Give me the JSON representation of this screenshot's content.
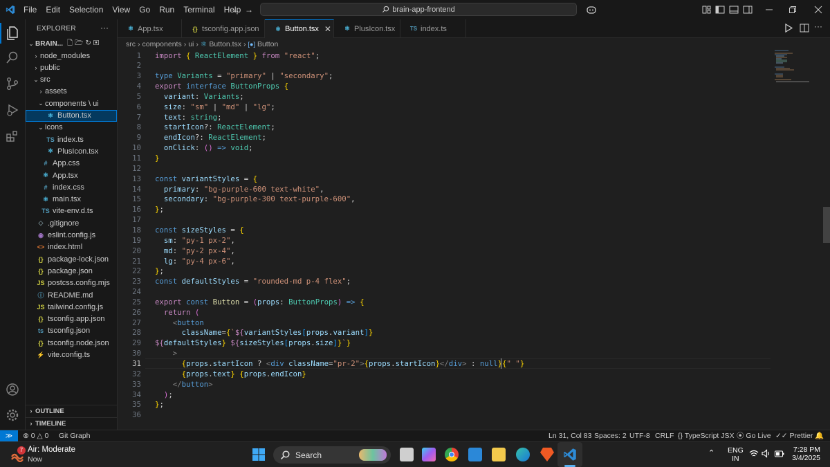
{
  "menu": [
    "File",
    "Edit",
    "Selection",
    "View",
    "Go",
    "Run",
    "Terminal",
    "Help"
  ],
  "command_center": "brain-app-frontend",
  "explorer": {
    "title": "EXPLORER",
    "root": "BRAIN...",
    "items": [
      {
        "label": "node_modules",
        "type": "folder",
        "depth": 1,
        "expanded": false
      },
      {
        "label": "public",
        "type": "folder",
        "depth": 1,
        "expanded": false
      },
      {
        "label": "src",
        "type": "folder",
        "depth": 1,
        "expanded": true
      },
      {
        "label": "assets",
        "type": "folder",
        "depth": 2,
        "expanded": false
      },
      {
        "label": "components \\ ui",
        "type": "folder",
        "depth": 2,
        "expanded": true
      },
      {
        "label": "Button.tsx",
        "type": "tsx",
        "depth": 3,
        "selected": true
      },
      {
        "label": "icons",
        "type": "folder",
        "depth": 2,
        "expanded": true
      },
      {
        "label": "index.ts",
        "type": "ts",
        "depth": 3
      },
      {
        "label": "PlusIcon.tsx",
        "type": "tsx",
        "depth": 3
      },
      {
        "label": "App.css",
        "type": "css",
        "depth": 2
      },
      {
        "label": "App.tsx",
        "type": "tsx",
        "depth": 2
      },
      {
        "label": "index.css",
        "type": "css",
        "depth": 2
      },
      {
        "label": "main.tsx",
        "type": "tsx",
        "depth": 2
      },
      {
        "label": "vite-env.d.ts",
        "type": "ts",
        "depth": 2
      },
      {
        "label": ".gitignore",
        "type": "git",
        "depth": 1
      },
      {
        "label": "eslint.config.js",
        "type": "eslint",
        "depth": 1
      },
      {
        "label": "index.html",
        "type": "html",
        "depth": 1
      },
      {
        "label": "package-lock.json",
        "type": "json",
        "depth": 1
      },
      {
        "label": "package.json",
        "type": "json",
        "depth": 1
      },
      {
        "label": "postcss.config.mjs",
        "type": "js",
        "depth": 1
      },
      {
        "label": "README.md",
        "type": "info",
        "depth": 1
      },
      {
        "label": "tailwind.config.js",
        "type": "js",
        "depth": 1
      },
      {
        "label": "tsconfig.app.json",
        "type": "json",
        "depth": 1
      },
      {
        "label": "tsconfig.json",
        "type": "tsjson",
        "depth": 1
      },
      {
        "label": "tsconfig.node.json",
        "type": "json",
        "depth": 1
      },
      {
        "label": "vite.config.ts",
        "type": "vite",
        "depth": 1
      }
    ],
    "outline": "OUTLINE",
    "timeline": "TIMELINE"
  },
  "tabs": [
    {
      "label": "App.tsx",
      "icon": "react",
      "active": false
    },
    {
      "label": "tsconfig.app.json",
      "icon": "json",
      "active": false
    },
    {
      "label": "Button.tsx",
      "icon": "react",
      "active": true
    },
    {
      "label": "PlusIcon.tsx",
      "icon": "react",
      "active": false
    },
    {
      "label": "index.ts",
      "icon": "ts",
      "active": false
    }
  ],
  "breadcrumb": [
    "src",
    "components",
    "ui",
    "Button.tsx",
    "Button"
  ],
  "editor": {
    "current_line": 31,
    "lines": [
      "import { ReactElement } from \"react\";",
      "",
      "type Variants = \"primary\" | \"secondary\";",
      "export interface ButtonProps {",
      "  variant: Variants;",
      "  size: \"sm\" | \"md\" | \"lg\";",
      "  text: string;",
      "  startIcon?: ReactElement;",
      "  endIcon?: ReactElement;",
      "  onClick: () => void;",
      "}",
      "",
      "const variantStyles = {",
      "  primary: \"bg-purple-600 text-white\",",
      "  secondary: \"bg-purple-300 text-purple-600\",",
      "};",
      "",
      "const sizeStyles = {",
      "  sm: \"py-1 px-2\",",
      "  md: \"py-2 px-4\",",
      "  lg: \"py-4 px-6\",",
      "};",
      "const defaultStyles = \"rounded-md p-4 flex\";",
      "",
      "export const Button = (props: ButtonProps) => {",
      "  return (",
      "    <button",
      "      className={`${variantStyles[props.variant]}",
      "${defaultStyles} ${sizeStyles[props.size]}`}",
      "    >",
      "      {props.startIcon ? <div className=\"pr-2\">{props.startIcon}</div> : null}{\" \"}",
      "      {props.text} {props.endIcon}",
      "    </button>",
      "  );",
      "};",
      ""
    ]
  },
  "statusbar": {
    "errors": "0",
    "warnings": "0",
    "git_graph": "Git Graph",
    "position": "Ln 31, Col 83",
    "spaces": "Spaces: 2",
    "encoding": "UTF-8",
    "eol": "CRLF",
    "language": "TypeScript JSX",
    "golive": "Go Live",
    "prettier": "Prettier"
  },
  "taskbar": {
    "weather_title": "Air: Moderate",
    "weather_sub": "Now",
    "weather_badge": "7",
    "search": "Search",
    "lang_top": "ENG",
    "lang_bottom": "IN",
    "time": "7:28 PM",
    "date": "3/4/2025"
  },
  "colors": {
    "accent": "#0078d4",
    "background": "#1f1f1f",
    "sidebar": "#181818"
  }
}
